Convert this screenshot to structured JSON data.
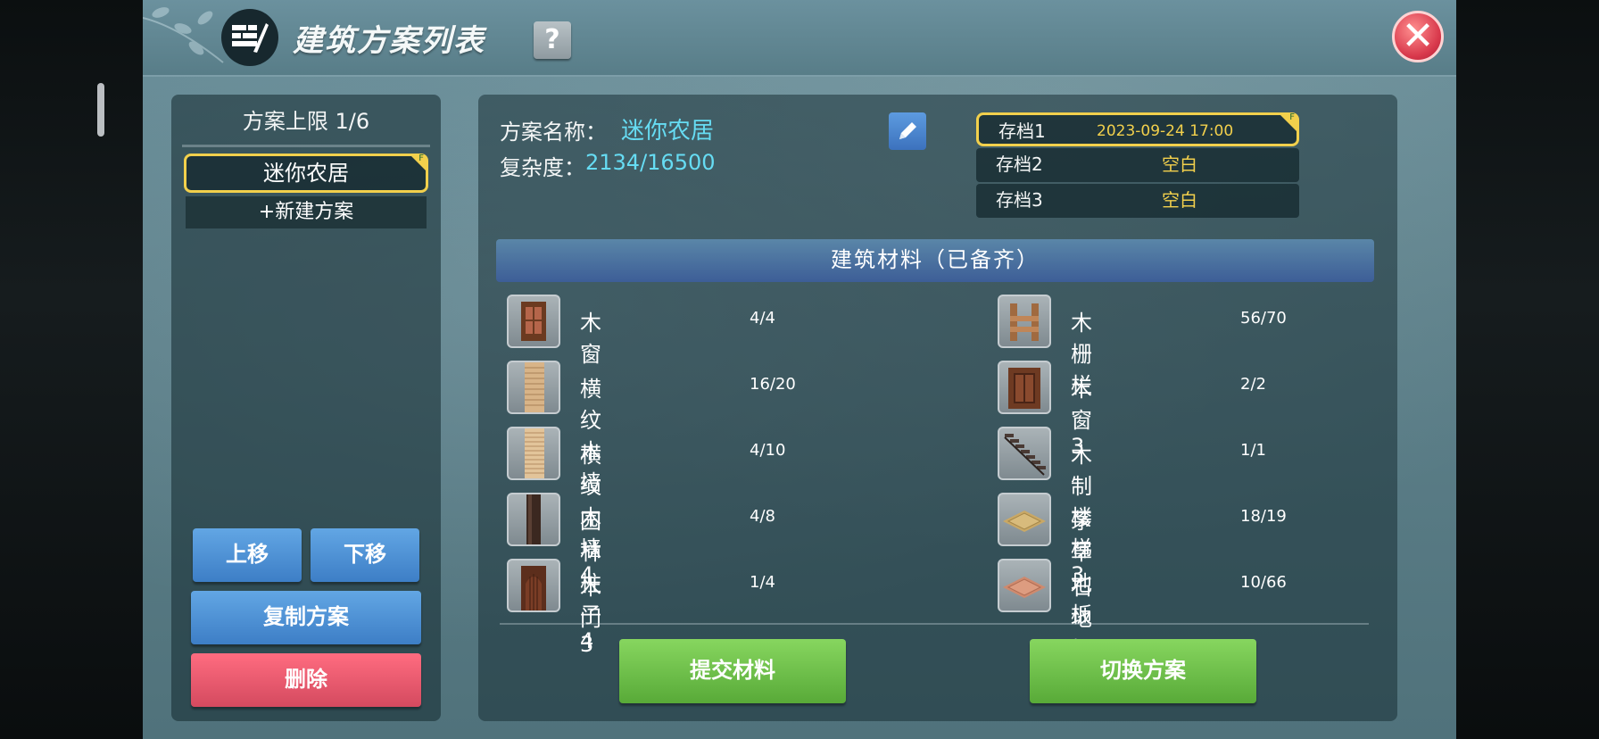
{
  "window": {
    "title": "建筑方案列表",
    "help_label": "?",
    "close_label": "✕"
  },
  "sidebar": {
    "limit_text": "方案上限 1/6",
    "plans": [
      {
        "name": "迷你农居",
        "selected": true,
        "badge": "F"
      }
    ],
    "new_plan_label": "+新建方案",
    "move_up_label": "上移",
    "move_down_label": "下移",
    "copy_label": "复制方案",
    "delete_label": "删除"
  },
  "plan": {
    "name_label": "方案名称：",
    "name_value": "迷你农居",
    "complexity_label": "复杂度：",
    "complexity_value": "2134/16500"
  },
  "saves": [
    {
      "name": "存档1",
      "value": "2023-09-24 17:00",
      "active": true,
      "badge": "F"
    },
    {
      "name": "存档2",
      "value": "空白",
      "active": false
    },
    {
      "name": "存档3",
      "value": "空白",
      "active": false
    }
  ],
  "materials": {
    "header": "建筑材料（已备齐）",
    "left": [
      {
        "icon": "wood-window-icon",
        "name": "木窗",
        "count": "4/4"
      },
      {
        "icon": "striped-wood-wall-icon",
        "name": "横纹木墙",
        "count": "16/20"
      },
      {
        "icon": "striped-wood-wall-4-icon",
        "name": "横纹木墙4",
        "count": "4/10"
      },
      {
        "icon": "garden-pillar-icon",
        "name": "园林柱子4",
        "count": "4/8"
      },
      {
        "icon": "wood-door-icon",
        "name": "木门3",
        "count": "1/4"
      }
    ],
    "right": [
      {
        "icon": "wood-fence-icon",
        "name": "木栅栏",
        "count": "56/70"
      },
      {
        "icon": "wood-window-3-icon",
        "name": "木窗3",
        "count": "2/2"
      },
      {
        "icon": "wood-stairs-icon",
        "name": "木制楼梯3",
        "count": "1/1"
      },
      {
        "icon": "thatch-floor-icon",
        "name": "茅草地板",
        "count": "18/19"
      },
      {
        "icon": "stone-floor-icon",
        "name": "石地板3",
        "count": "10/66"
      }
    ]
  },
  "actions": {
    "submit_label": "提交材料",
    "switch_label": "切换方案"
  },
  "colors": {
    "accent_yellow": "#f2d04c",
    "cyan_text": "#66dcf3",
    "green_button": "#6cc04a",
    "blue_button": "#4a8ad0",
    "red_button": "#e85a6f"
  }
}
